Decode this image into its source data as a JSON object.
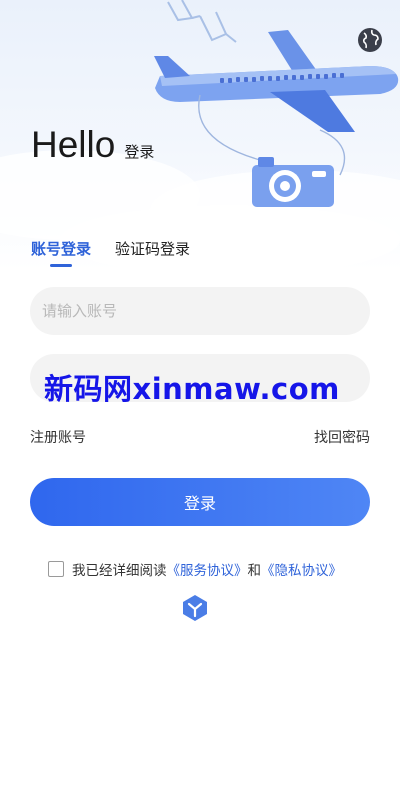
{
  "header": {
    "hello": "Hello",
    "subtitle": "登录",
    "globe_icon": "globe-icon"
  },
  "tabs": [
    {
      "label": "账号登录",
      "active": true
    },
    {
      "label": "验证码登录",
      "active": false
    }
  ],
  "form": {
    "account_placeholder": "请输入账号",
    "password_value": "",
    "register_label": "注册账号",
    "forgot_label": "找回密码",
    "login_label": "登录"
  },
  "agreement": {
    "checked": false,
    "prefix": "我已经详细阅读",
    "service_link": "《服务协议》",
    "conjunction": "和",
    "privacy_link": "《隐私协议》"
  },
  "watermark": "新码网xinmaw.com",
  "colors": {
    "accent": "#2f63d9",
    "button_start": "#2f67ee",
    "button_end": "#4f86f5",
    "watermark": "#1515e8"
  }
}
